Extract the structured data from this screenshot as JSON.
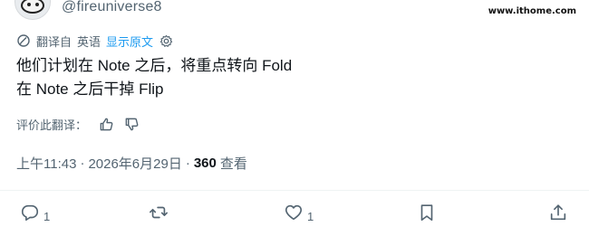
{
  "author": {
    "handle": "@fireuniverse8"
  },
  "watermark": "www.ithome.com",
  "translation": {
    "translated_from": "翻译自",
    "language": "英语",
    "show_original": "显示原文"
  },
  "tweet": {
    "lines": [
      "他们计划在 Note 之后，将重点转向 Fold",
      "在 Note 之后干掉 Flip"
    ]
  },
  "rate": {
    "label": "评价此翻译："
  },
  "meta": {
    "time": "上午11:43",
    "separator": "·",
    "date": "2026年6月29日",
    "views_count": "360",
    "views_label": "查看"
  },
  "actions": {
    "reply_count": "1",
    "like_count": "1"
  },
  "icons": [
    "translate-icon",
    "gear-icon",
    "thumbs-up-icon",
    "thumbs-down-icon",
    "reply-icon",
    "retweet-icon",
    "like-icon",
    "bookmark-icon",
    "share-icon"
  ],
  "colors": {
    "accent": "#1d9bf0",
    "muted": "#536471",
    "text": "#0f1419"
  }
}
